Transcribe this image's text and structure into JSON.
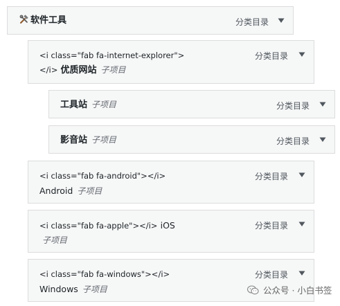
{
  "items": [
    {
      "title": "软件工具",
      "type": "分类目录",
      "depth": 0
    },
    {
      "code": "<i class=\"fab fa-internet-explorer\">",
      "code_line2": "</i>",
      "label": "优质网站",
      "sub": "子项目",
      "type": "分类目录",
      "depth": 1
    },
    {
      "label": "工具站",
      "sub": "子项目",
      "type": "分类目录",
      "depth": 2
    },
    {
      "label": "影音站",
      "sub": "子项目",
      "type": "分类目录",
      "depth": 2
    },
    {
      "code": "<i class=\"fab fa-android\"></i>",
      "label": "Android",
      "sub": "子项目",
      "type": "分类目录",
      "depth": 1
    },
    {
      "code": "<i class=\"fab fa-apple\"></i>",
      "label": "iOS",
      "sub": "子项目",
      "type": "分类目录",
      "depth": 1
    },
    {
      "code": "<i class=\"fab fa-windows\"></i>",
      "label": "Windows",
      "sub": "子项目",
      "type": "分类目录",
      "depth": 1
    }
  ],
  "watermark": {
    "text": "公众号 · 小白书签"
  },
  "icons": {
    "toggle": "triangle-down-icon",
    "tools": "hammer-wrench-icon",
    "watermark": "wechat-icon"
  },
  "colors": {
    "item_bg": "#f6f7f7",
    "item_border": "#dcdcde",
    "toggle": "#50575e",
    "subitem": "#646970"
  }
}
